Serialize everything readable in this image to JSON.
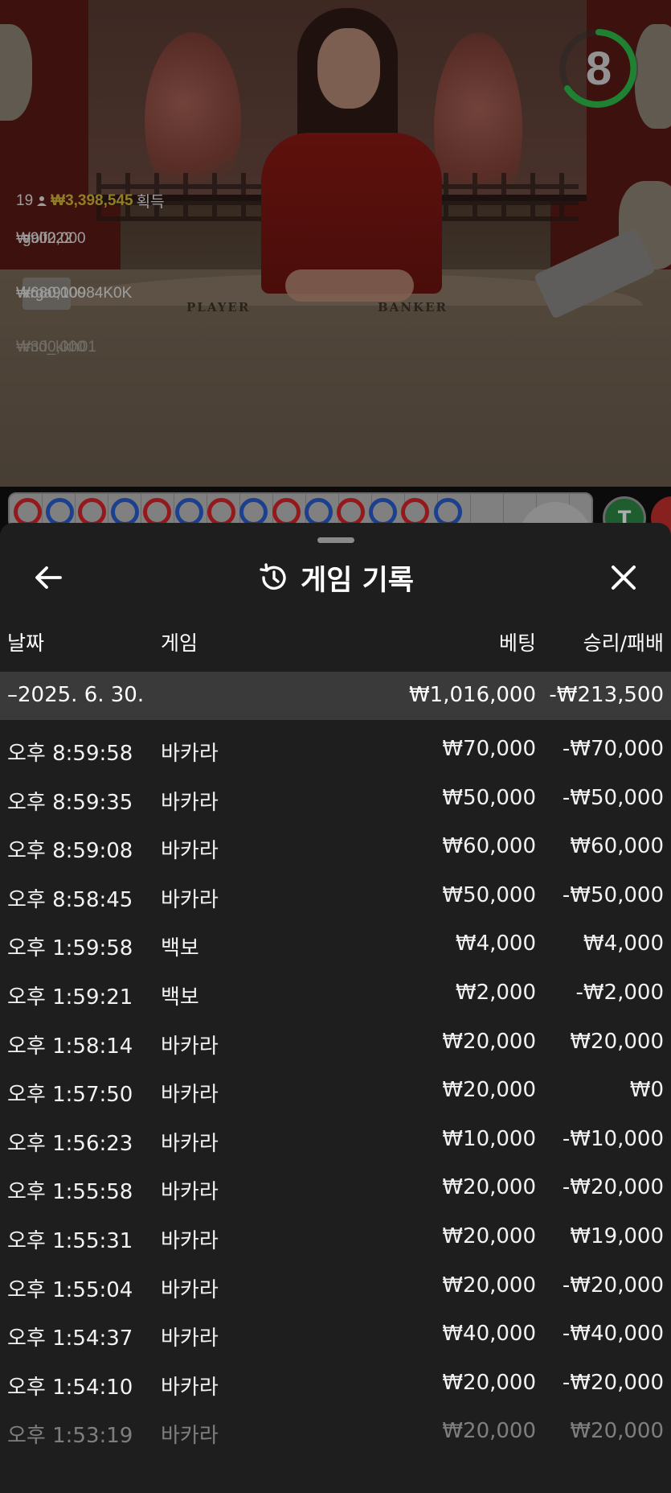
{
  "video": {
    "timer": "8",
    "table_player": "PLAYER",
    "table_banker": "BANKER",
    "winners": {
      "count": "19",
      "total": "₩3,398,545",
      "suffix": "획득",
      "list": [
        {
          "amount": "₩900,000",
          "user": "golf222"
        },
        {
          "amount": "₩680,000",
          "user": "krga910984K0K"
        },
        {
          "amount": "₩300,000",
          "user": "imd_kkh01"
        }
      ]
    }
  },
  "road": {
    "beads": [
      "red",
      "blue",
      "red",
      "blue",
      "red",
      "blue",
      "red",
      "blue",
      "red",
      "blue",
      "red",
      "blue",
      "red",
      "blue"
    ],
    "tie_label": "T"
  },
  "sheet": {
    "title": "게임 기록",
    "columns": {
      "date": "날짜",
      "game": "게임",
      "bet": "베팅",
      "winloss": "승리/패배"
    },
    "date_group": {
      "date": "–2025. 6. 30.",
      "bet": "₩1,016,000",
      "winloss": "-₩213,500"
    },
    "rows": [
      {
        "time": "오후 8:59:58",
        "game": "바카라",
        "bet": "₩70,000",
        "winloss": "-₩70,000"
      },
      {
        "time": "오후 8:59:35",
        "game": "바카라",
        "bet": "₩50,000",
        "winloss": "-₩50,000"
      },
      {
        "time": "오후 8:59:08",
        "game": "바카라",
        "bet": "₩60,000",
        "winloss": "₩60,000"
      },
      {
        "time": "오후 8:58:45",
        "game": "바카라",
        "bet": "₩50,000",
        "winloss": "-₩50,000"
      },
      {
        "time": "오후 1:59:58",
        "game": "백보",
        "bet": "₩4,000",
        "winloss": "₩4,000"
      },
      {
        "time": "오후 1:59:21",
        "game": "백보",
        "bet": "₩2,000",
        "winloss": "-₩2,000"
      },
      {
        "time": "오후 1:58:14",
        "game": "바카라",
        "bet": "₩20,000",
        "winloss": "₩20,000"
      },
      {
        "time": "오후 1:57:50",
        "game": "바카라",
        "bet": "₩20,000",
        "winloss": "₩0"
      },
      {
        "time": "오후 1:56:23",
        "game": "바카라",
        "bet": "₩10,000",
        "winloss": "-₩10,000"
      },
      {
        "time": "오후 1:55:58",
        "game": "바카라",
        "bet": "₩20,000",
        "winloss": "-₩20,000"
      },
      {
        "time": "오후 1:55:31",
        "game": "바카라",
        "bet": "₩20,000",
        "winloss": "₩19,000"
      },
      {
        "time": "오후 1:55:04",
        "game": "바카라",
        "bet": "₩20,000",
        "winloss": "-₩20,000"
      },
      {
        "time": "오후 1:54:37",
        "game": "바카라",
        "bet": "₩40,000",
        "winloss": "-₩40,000"
      },
      {
        "time": "오후 1:54:10",
        "game": "바카라",
        "bet": "₩20,000",
        "winloss": "-₩20,000"
      },
      {
        "time": "오후 1:53:19",
        "game": "바카라",
        "bet": "₩20,000",
        "winloss": "₩20,000"
      }
    ]
  },
  "icons": {
    "back": "arrow-left-icon",
    "history": "history-icon",
    "close": "close-icon",
    "user": "user-icon"
  },
  "colors": {
    "sheet_bg": "#1e1e1e",
    "date_row_bg": "#3a3a3a",
    "timer_green": "#2fbf4a",
    "winner_gold": "#d6b83a",
    "banker_red": "#d9252b",
    "player_blue": "#2a5fd0",
    "tie_green": "#2b8a45"
  }
}
